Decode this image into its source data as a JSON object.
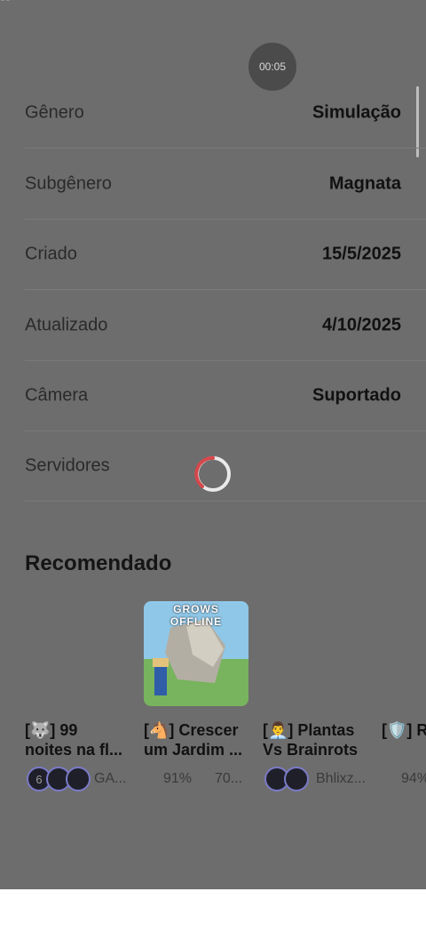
{
  "status": {
    "corner_text": "es",
    "timer": "00:05"
  },
  "details": [
    {
      "label": "Gênero",
      "value": "Simulação"
    },
    {
      "label": "Subgênero",
      "value": "Magnata"
    },
    {
      "label": "Criado",
      "value": "15/5/2025"
    },
    {
      "label": "Atualizado",
      "value": "4/10/2025"
    },
    {
      "label": "Câmera",
      "value": "Suportado"
    },
    {
      "label": "Servidores",
      "value": ""
    }
  ],
  "recommended": {
    "title": "Recomendado",
    "cards": [
      {
        "title_line1": "[🐺] 99",
        "title_line2": "noites na fl...",
        "meta_text": "GA...",
        "avatar_count": "6"
      },
      {
        "title_line1": "[🐴] Crescer",
        "title_line2": "um Jardim ...",
        "thumb_text": "GROWS OFFLINE",
        "rating": "91%",
        "players": "70..."
      },
      {
        "title_line1": "[👨‍💼] Plantas",
        "title_line2": "Vs Brainrots",
        "meta_text": "Bhlixz..."
      },
      {
        "title_line1": "[🛡️] R",
        "title_line2": "",
        "rating": "94%"
      }
    ]
  }
}
